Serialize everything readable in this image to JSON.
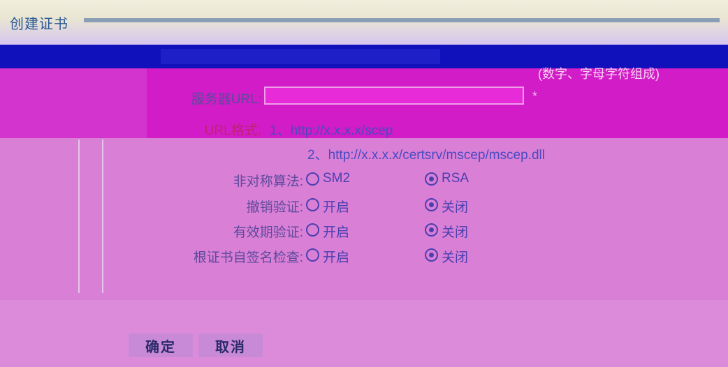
{
  "window": {
    "title": "创建证书"
  },
  "form": {
    "server_url": {
      "label": "服务器URL:",
      "value": "",
      "required_mark": "*",
      "hint": "(数字、字母字符组成)"
    },
    "url_format": {
      "label": "URL格式:",
      "line1": "1、http://x.x.x.x/scep",
      "line2": "2、http://x.x.x.x/certsrv/mscep/mscep.dll"
    },
    "asym_algo": {
      "label": "非对称算法:",
      "options": [
        "SM2",
        "RSA"
      ],
      "selected": "RSA"
    },
    "revocation_check": {
      "label": "撤销验证:",
      "options": [
        "开启",
        "关闭"
      ],
      "selected": "关闭"
    },
    "validity_check": {
      "label": "有效期验证:",
      "options": [
        "开启",
        "关闭"
      ],
      "selected": "关闭"
    },
    "root_self_sign_check": {
      "label": "根证书自签名检查:",
      "options": [
        "开启",
        "关闭"
      ],
      "selected": "关闭"
    }
  },
  "buttons": {
    "confirm": "确定",
    "cancel": "取消"
  },
  "colors": {
    "title_text": "#2c5a93",
    "header_band": "#1111bb",
    "form_band": "#d21cc7",
    "panel_bg": "#da7fd6",
    "radio": "#4b3fb0"
  }
}
